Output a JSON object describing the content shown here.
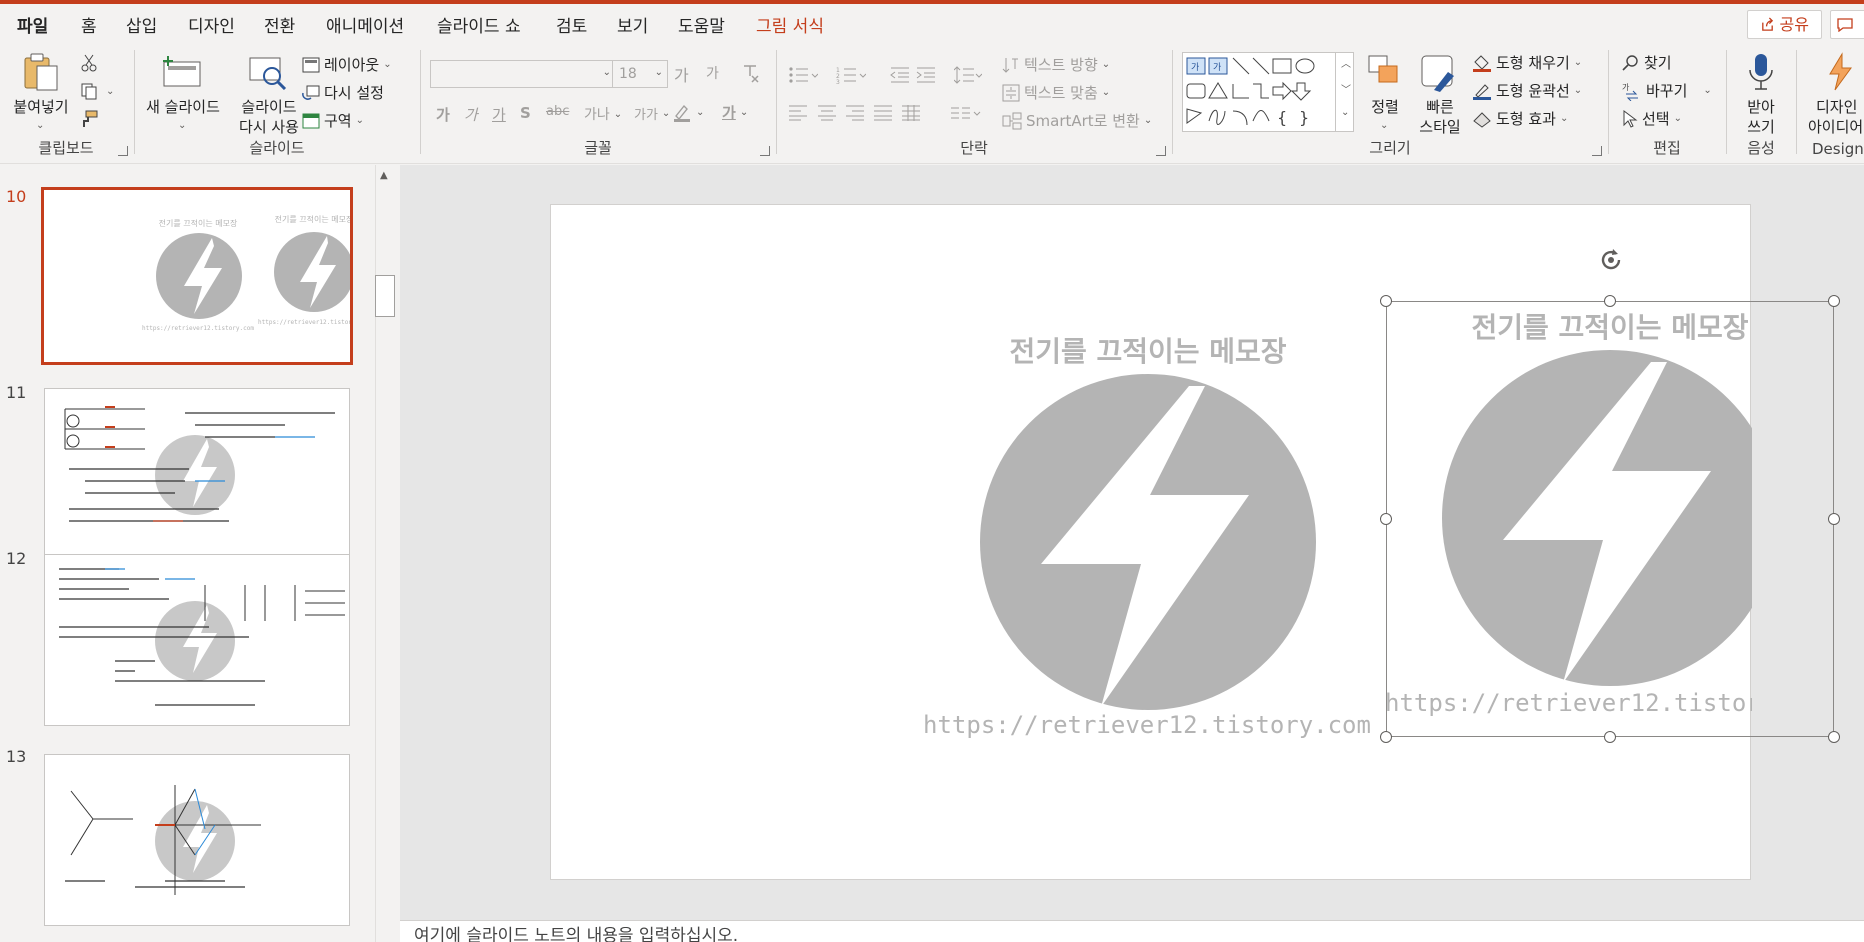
{
  "tabs": [
    "파일",
    "홈",
    "삽입",
    "디자인",
    "전환",
    "애니메이션",
    "슬라이드 쇼",
    "검토",
    "보기",
    "도움말",
    "그림 서식"
  ],
  "share_label": "공유",
  "ribbon": {
    "clipboard": {
      "paste": "붙여넣기",
      "group": "클립보드"
    },
    "slides": {
      "new_slide": "새 슬라이드",
      "reuse_slide": "슬라이드",
      "reuse_slide2": "다시 사용",
      "layout": "레이아웃",
      "reset": "다시 설정",
      "section": "구역",
      "group": "슬라이드"
    },
    "font": {
      "font_size": "18",
      "group": "글꼴",
      "grow": "가",
      "shrink": "가",
      "bold": "가",
      "italic": "가",
      "underline": "가",
      "strike": "S",
      "shadow": "가나",
      "spacing": "가가",
      "font_color": "가"
    },
    "paragraph": {
      "text_direction": "텍스트 방향",
      "align_text": "텍스트 맞춤",
      "smartart": "SmartArt로 변환",
      "group": "단락"
    },
    "drawing": {
      "arrange": "정렬",
      "quick_styles": "빠른",
      "quick_styles2": "스타일",
      "shape_fill": "도형 채우기",
      "shape_outline": "도형 윤곽선",
      "shape_effects": "도형 효과",
      "group": "그리기"
    },
    "editing": {
      "find": "찾기",
      "replace": "바꾸기",
      "select": "선택",
      "group": "편집"
    },
    "voice": {
      "dictate": "받아",
      "dictate2": "쓰기",
      "group": "음성"
    },
    "designer": {
      "ideas": "디자인",
      "ideas2": "아이디어",
      "group": "Designer"
    }
  },
  "slides_panel": [
    {
      "number": "10",
      "selected": true
    },
    {
      "number": "11",
      "selected": false
    },
    {
      "number": "12",
      "selected": false
    },
    {
      "number": "13",
      "selected": false
    }
  ],
  "watermark": {
    "title": "전기를 끄적이는 메모장",
    "url": "https://retriever12.tistory.com",
    "color": "#b4b4b4"
  },
  "notes_placeholder": "여기에 슬라이드 노트의 내용을 입력하십시오.",
  "colors": {
    "accent": "#c43e1c"
  }
}
